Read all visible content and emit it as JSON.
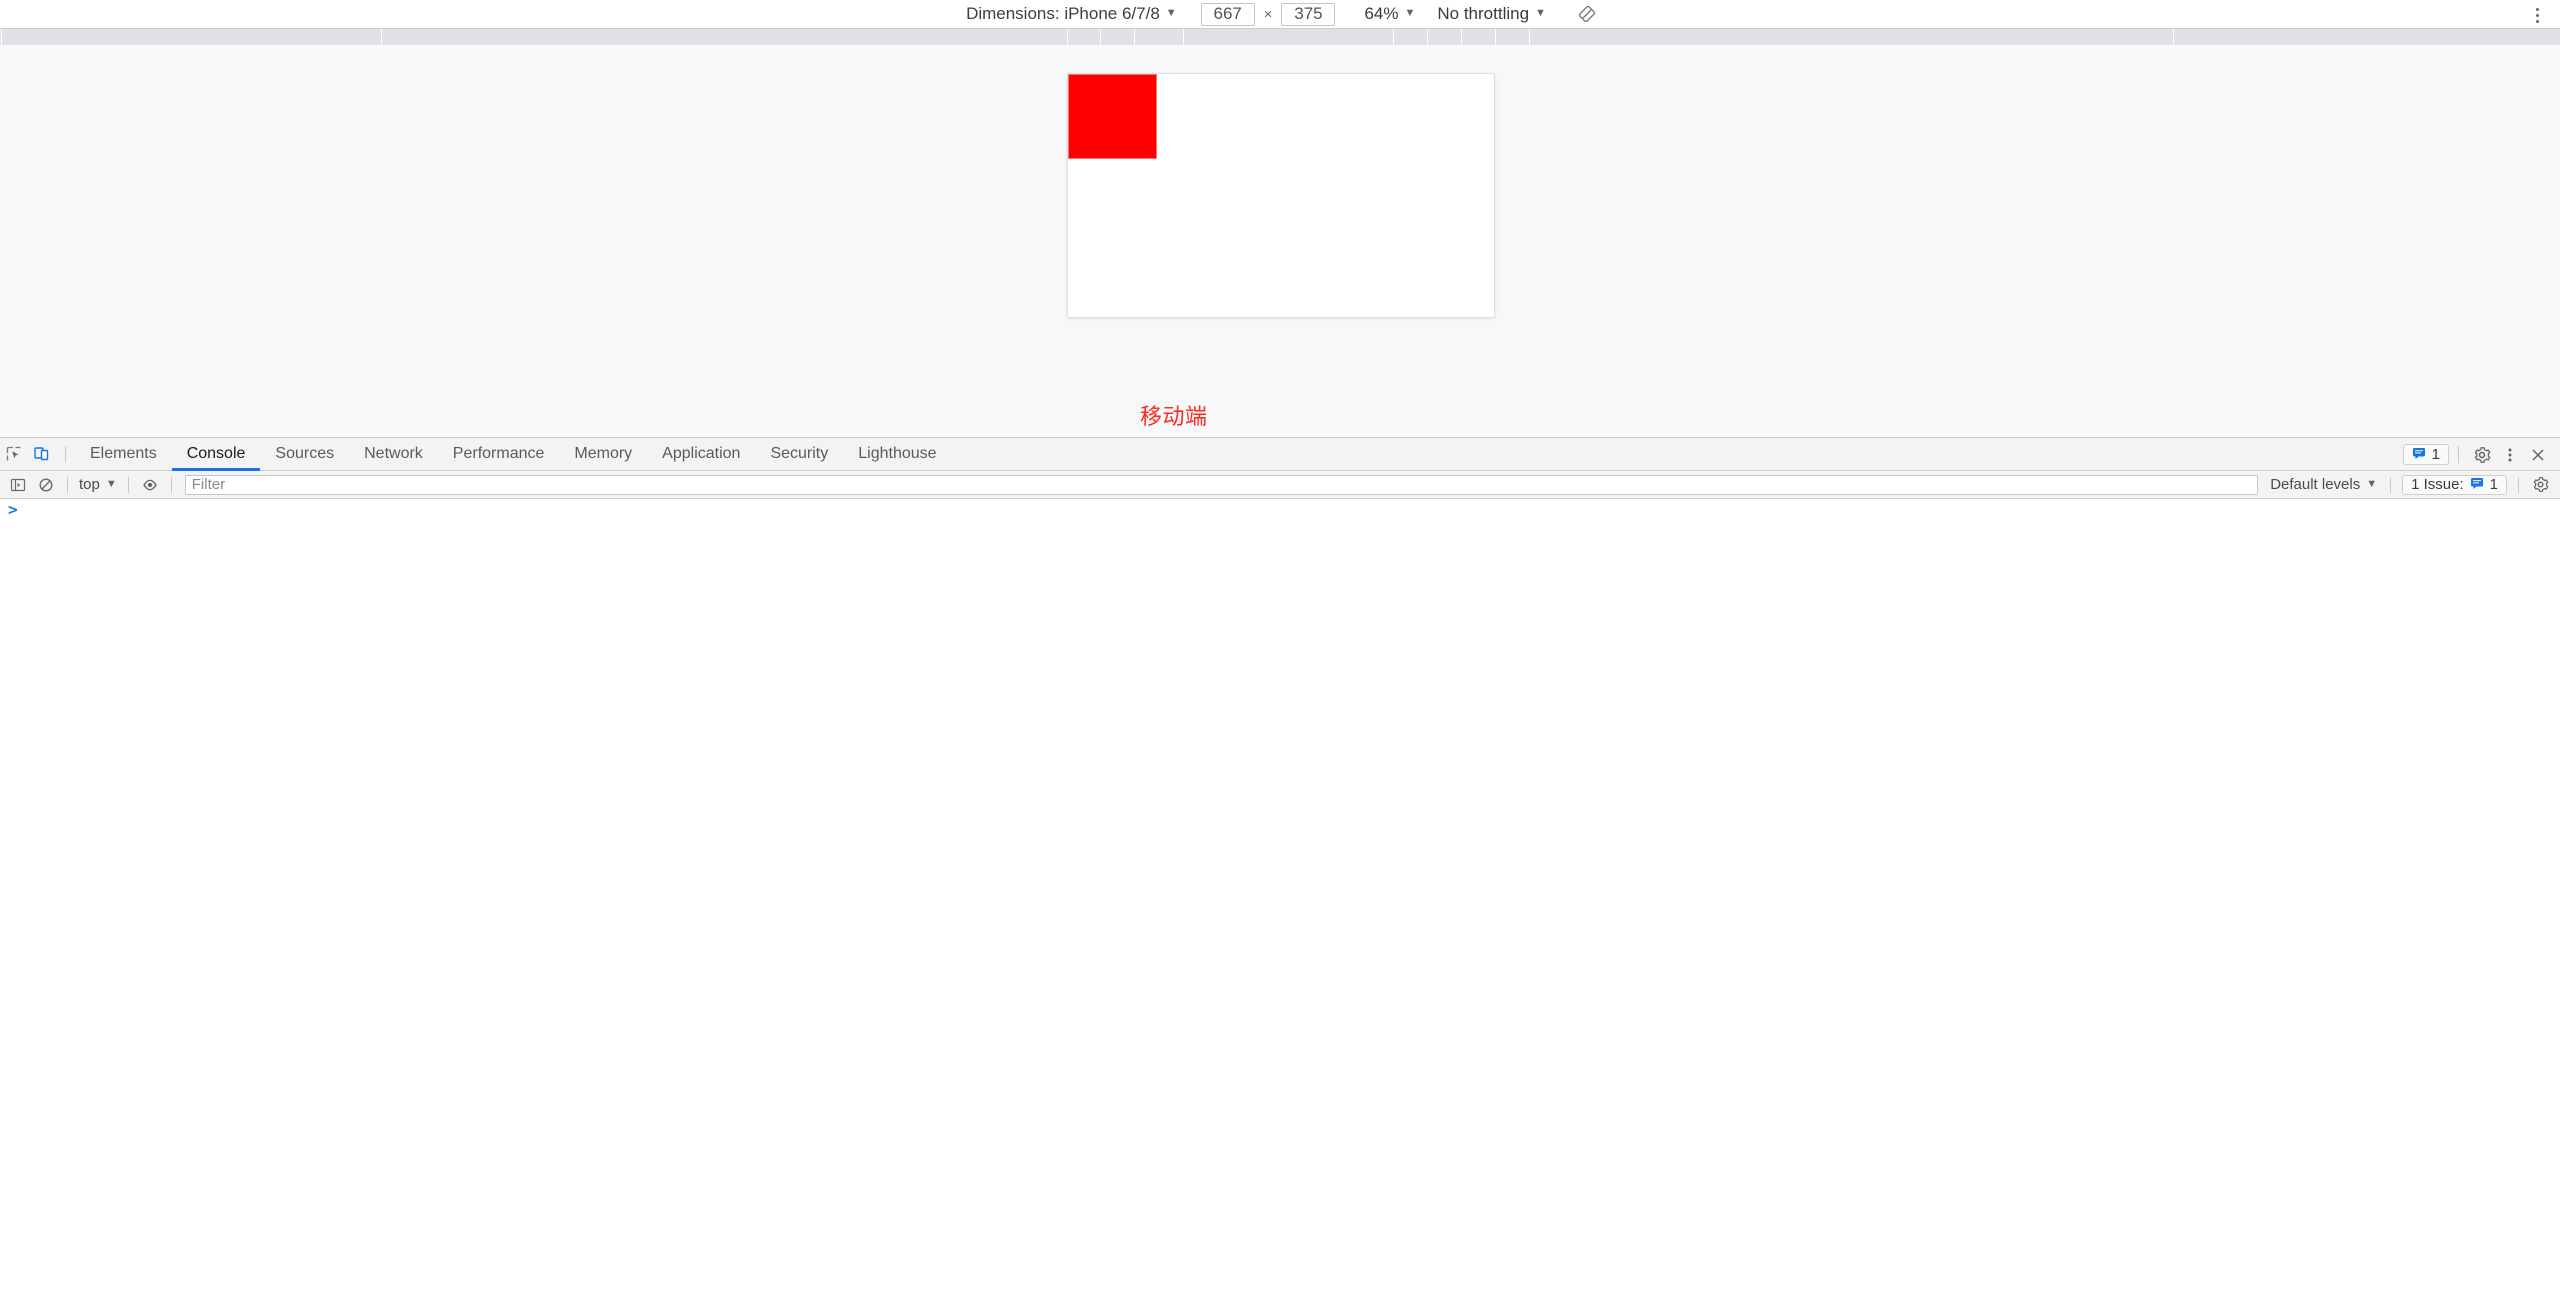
{
  "device_toolbar": {
    "dimensions_label": "Dimensions: iPhone 6/7/8",
    "width_value": "667",
    "height_value": "375",
    "separator": "×",
    "zoom_label": "64%",
    "throttling_label": "No throttling",
    "rotate_icon": "rotate-icon",
    "more_options_icon": "kebab-menu-icon",
    "caret": "▼"
  },
  "page": {
    "viewport_bg": "#ffffff",
    "red_box_color": "#ff0000",
    "mobile_text": "移动端",
    "mobile_text_color": "#fd2a1e"
  },
  "devtools": {
    "left_icons": [
      {
        "name": "inspect-element-icon",
        "title": "Inspect element"
      },
      {
        "name": "device-toolbar-icon",
        "title": "Toggle device toolbar",
        "active": true
      }
    ],
    "tabs": [
      {
        "label": "Elements",
        "active": false
      },
      {
        "label": "Console",
        "active": true
      },
      {
        "label": "Sources",
        "active": false
      },
      {
        "label": "Network",
        "active": false
      },
      {
        "label": "Performance",
        "active": false
      },
      {
        "label": "Memory",
        "active": false
      },
      {
        "label": "Application",
        "active": false
      },
      {
        "label": "Security",
        "active": false
      },
      {
        "label": "Lighthouse",
        "active": false
      }
    ],
    "tabbar_right": {
      "issue_count": "1",
      "issue_icon": "issue-message-icon",
      "settings_icon": "gear-icon",
      "more_icon": "kebab-menu-icon",
      "close_icon": "close-icon"
    },
    "console_toolbar": {
      "sidebar_icon": "console-sidebar-icon",
      "clear_icon": "clear-console-icon",
      "context_label": "top",
      "caret": "▼",
      "eye_icon": "live-expression-eye-icon",
      "filter_placeholder": "Filter",
      "filter_value": "",
      "levels_label": "Default levels",
      "issues_label": "1 Issue:",
      "issues_count": "1",
      "settings_icon": "gear-icon"
    },
    "console_body": {
      "prompt_symbol": ">",
      "messages": []
    }
  },
  "colors": {
    "accent_blue": "#1a73e8",
    "toolbar_bg": "#f3f3f3",
    "page_bg": "#f7f8f9",
    "ruler_bg": "#dfe1e5",
    "red": "#ff0000"
  }
}
